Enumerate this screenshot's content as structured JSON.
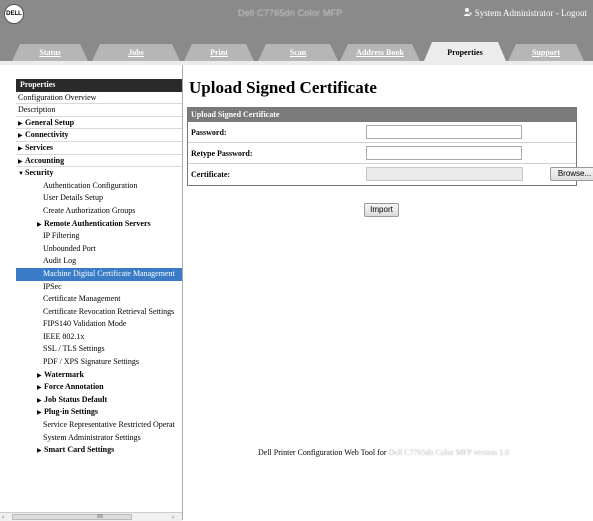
{
  "header": {
    "logo_text": "DELL",
    "device_title": "Dell C7765dn Color MFP",
    "user_label": "System Administrator",
    "logout_label": "Logout",
    "user_icon": "user-icon"
  },
  "tabs": [
    {
      "label": "Status",
      "active": false
    },
    {
      "label": "Jobs",
      "active": false
    },
    {
      "label": "Print",
      "active": false
    },
    {
      "label": "Scan",
      "active": false
    },
    {
      "label": "Address Book",
      "active": false
    },
    {
      "label": "Properties",
      "active": true
    },
    {
      "label": "Support",
      "active": false
    }
  ],
  "nav": {
    "items": [
      {
        "label": "Properties"
      },
      {
        "label": "Configuration Overview"
      },
      {
        "label": "Description"
      },
      {
        "label": "General Setup",
        "expander": "▶"
      },
      {
        "label": "Connectivity",
        "expander": "▶"
      },
      {
        "label": "Services",
        "expander": "▶"
      },
      {
        "label": "Accounting",
        "expander": "▶"
      },
      {
        "label": "Security",
        "expander": "▼"
      },
      {
        "label": "Authentication Configuration"
      },
      {
        "label": "User Details Setup"
      },
      {
        "label": "Create Authorization Groups"
      },
      {
        "label": "Remote Authentication Servers",
        "expander": "▶"
      },
      {
        "label": "IP Filtering"
      },
      {
        "label": "Unbounded Port"
      },
      {
        "label": "Audit Log"
      },
      {
        "label": "Machine Digital Certificate Management"
      },
      {
        "label": "IPSec"
      },
      {
        "label": "Certificate Management"
      },
      {
        "label": "Certificate Revocation Retrieval Settings"
      },
      {
        "label": "FIPS140 Validation Mode"
      },
      {
        "label": "IEEE 802.1x"
      },
      {
        "label": "SSL / TLS Settings"
      },
      {
        "label": "PDF / XPS Signature Settings"
      },
      {
        "label": "Watermark",
        "expander": "▶"
      },
      {
        "label": "Force Annotation",
        "expander": "▶"
      },
      {
        "label": "Job Status Default",
        "expander": "▶"
      },
      {
        "label": "Plug-in Settings",
        "expander": "▶"
      },
      {
        "label": "Service Representative Restricted Operat"
      },
      {
        "label": "System Administrator Settings"
      },
      {
        "label": "Smart Card Settings",
        "expander": "▶"
      }
    ]
  },
  "scrollbar": {
    "left": "‹",
    "right": "›",
    "grip": "III"
  },
  "main": {
    "title": "Upload Signed Certificate",
    "form_header": "Upload Signed Certificate",
    "password_label": "Password:",
    "retype_label": "Retype Password:",
    "certificate_label": "Certificate:",
    "browse_label": "Browse...",
    "import_label": "Import"
  },
  "footer": {
    "text": "Dell Printer Configuration Web Tool for",
    "model": "Dell C7765dn Color MFP version 1.0"
  },
  "colors": {
    "header_bg": "#8a8a8a",
    "tab_bg": "#b6b6b6",
    "selected_nav": "#3a7bc8",
    "form_header_bg": "#7a7a7a"
  }
}
